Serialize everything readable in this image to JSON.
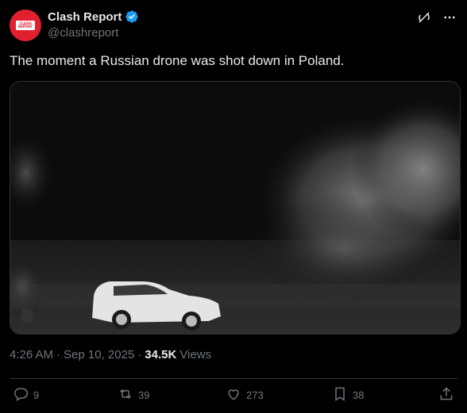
{
  "author": {
    "display_name": "Clash Report",
    "handle": "@clashreport",
    "logo_text_line1": "CLASH",
    "logo_text_line2": "REPORT",
    "avatar_color": "#e0202e",
    "verified_color": "#1d9bf0"
  },
  "tweet": {
    "text": "The moment a Russian drone was shot down in Poland."
  },
  "media": {
    "kind": "video-still",
    "scene": "night thermal footage with a white car and smoke cloud"
  },
  "meta": {
    "time": "4:26 AM",
    "separator1": "·",
    "date": "Sep 10, 2025",
    "separator2": "·",
    "views_count": "34.5K",
    "views_label": "Views"
  },
  "actions": {
    "reply_count": "9",
    "repost_count": "39",
    "like_count": "273",
    "bookmark_count": "38"
  },
  "icons": {
    "grok": "grok-icon",
    "more": "more-icon",
    "reply": "reply-icon",
    "repost": "repost-icon",
    "like": "heart-icon",
    "bookmark": "bookmark-icon",
    "share": "share-icon"
  }
}
